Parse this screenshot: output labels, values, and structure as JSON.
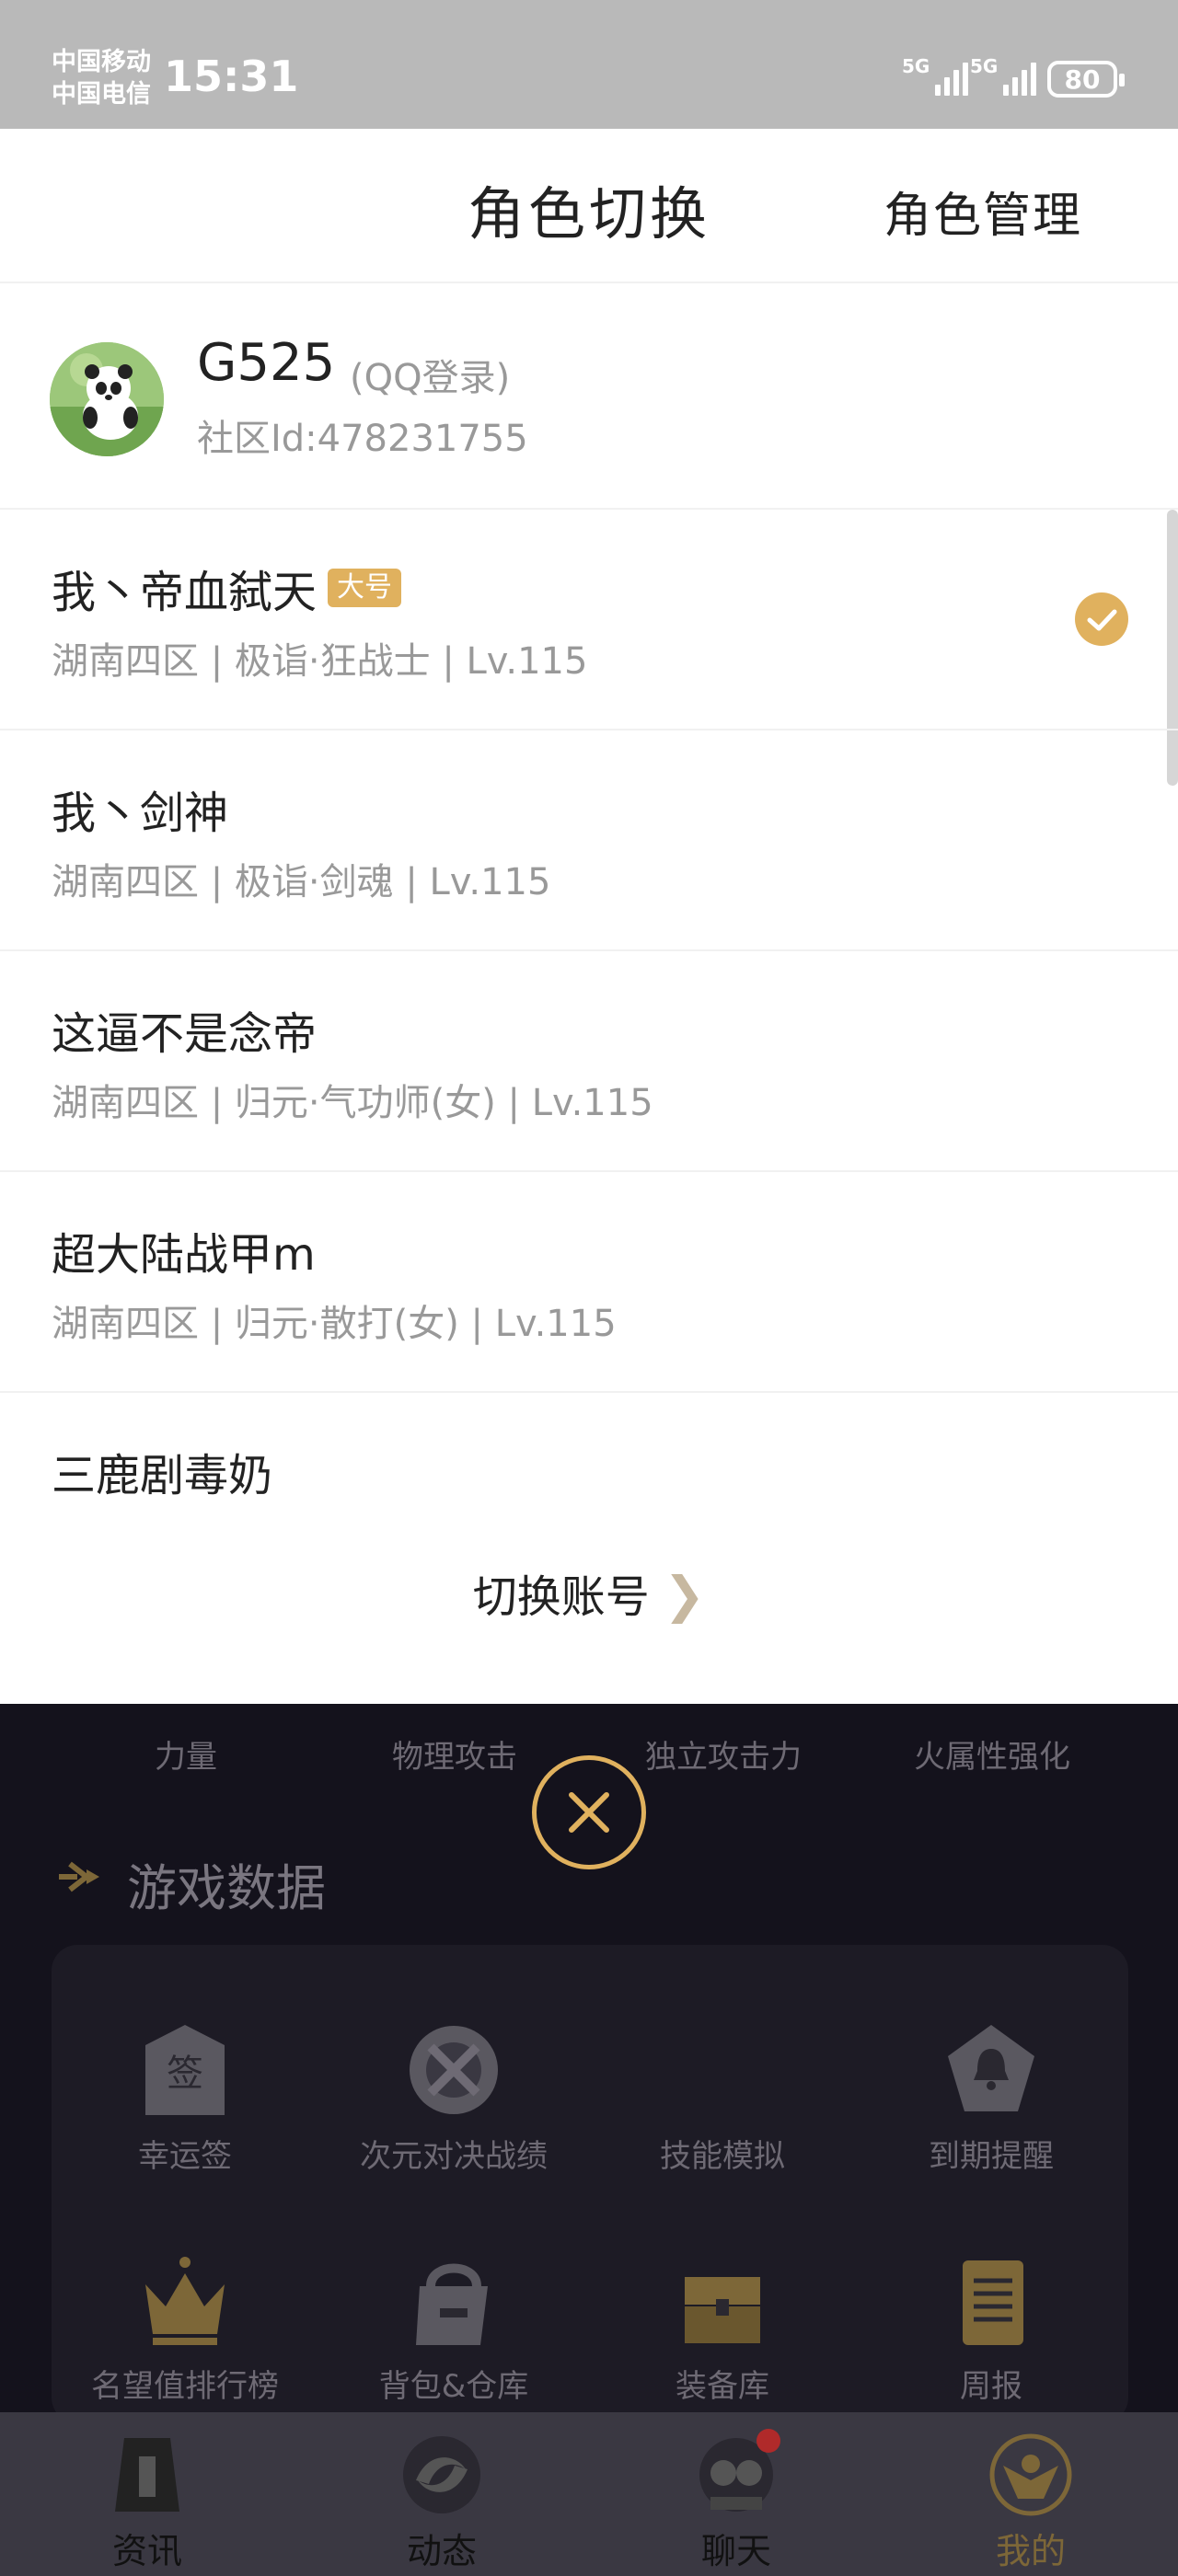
{
  "status_bar": {
    "carrier_1": "中国移动",
    "carrier_2": "中国电信",
    "time": "15:31",
    "signal_1": "5G",
    "signal_2": "5G",
    "battery": "80"
  },
  "sheet": {
    "title": "角色切换",
    "manage_label": "角色管理",
    "account": {
      "name": "G525",
      "login_type": "(QQ登录)",
      "community_id": "社区Id:478231755"
    },
    "roles": [
      {
        "name": "我丶帝血弑天",
        "badge": "大号",
        "info": "湖南四区 | 极诣·狂战士 | Lv.115",
        "selected": true
      },
      {
        "name": "我丶剑神",
        "info": "湖南四区 | 极诣·剑魂 | Lv.115"
      },
      {
        "name": "这逼不是念帝",
        "info": "湖南四区 | 归元·气功师(女) | Lv.115"
      },
      {
        "name": "超大陆战甲m",
        "info": "湖南四区 | 归元·散打(女) | Lv.115"
      },
      {
        "name": "三鹿剧毒奶",
        "info": ""
      }
    ],
    "switch_account_label": "切换账号",
    "switch_chevron": "❯"
  },
  "background_app": {
    "attributes": [
      "力量",
      "物理攻击",
      "独立攻击力",
      "火属性强化"
    ],
    "section_title": "游戏数据",
    "tools": [
      {
        "label": "幸运签",
        "icon": "lucky-sign-icon"
      },
      {
        "label": "次元对决战绩",
        "icon": "dimension-duel-icon"
      },
      {
        "label": "技能模拟",
        "icon": "skill-sim-icon"
      },
      {
        "label": "到期提醒",
        "icon": "bell-icon"
      },
      {
        "label": "名望值排行榜",
        "icon": "crown-icon"
      },
      {
        "label": "背包&仓库",
        "icon": "backpack-icon"
      },
      {
        "label": "装备库",
        "icon": "treasure-chest-icon"
      },
      {
        "label": "周报",
        "icon": "scroll-icon"
      }
    ]
  },
  "tabbar": {
    "tabs": [
      {
        "label": "资讯",
        "active": false
      },
      {
        "label": "动态",
        "active": false
      },
      {
        "label": "聊天",
        "active": false
      },
      {
        "label": "我的",
        "active": true
      }
    ]
  },
  "colors": {
    "accent": "#e0b15e",
    "background_dark": "#14121c"
  }
}
